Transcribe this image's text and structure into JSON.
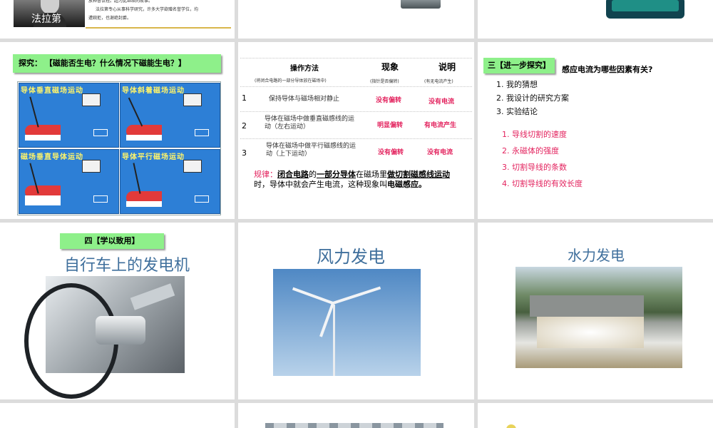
{
  "slide1": {
    "name_caption": "法拉第",
    "bio_line1": "放种督议程。超为此继续的故事。",
    "bio_line2": "法拉第专心从事科学研究，许多大学欲赠名誉学位，均",
    "bio_line3": "遭婉拒，也谢绝封爵。"
  },
  "slide4": {
    "heading": "探究：  【磁能否生电？什么情况下磁能生电？】",
    "panels": [
      {
        "title": "导体垂直磁场运动"
      },
      {
        "title": "导体斜着磁场运动"
      },
      {
        "title": "磁场垂直导体运动"
      },
      {
        "title": "导体平行磁场运动"
      }
    ]
  },
  "slide5": {
    "headers": {
      "method": "操作方法",
      "method_note": "(将闭合电路的一部分导体放在磁场中)",
      "phenomenon": "现象",
      "phenomenon_note": "(指针是否偏转)",
      "explain": "说明",
      "explain_note": "(有无电流产生)"
    },
    "rows": [
      {
        "num": "1",
        "method": "保持导体与磁场相对静止",
        "phenomenon": "没有偏转",
        "explain": "没有电流"
      },
      {
        "num": "2",
        "method": "导体在磁场中做垂直磁感线的运动（左右运动）",
        "phenomenon": "明显偏转",
        "explain": "有电流产生"
      },
      {
        "num": "3",
        "method": "导体在磁场中做平行磁感线的运动（上下运动）",
        "phenomenon": "没有偏转",
        "explain": "没有电流"
      }
    ],
    "rule_label": "规律：",
    "rule_part1": "闭合电路",
    "rule_part2": "的",
    "rule_part3": "一部分导体",
    "rule_part4": "在磁场里",
    "rule_part5": "做切割磁感线运动",
    "rule_part6": "时，导体中就会产生电流，这种现象叫",
    "rule_part7": "电磁感应。"
  },
  "slide6": {
    "tag": "三【进一步探究】",
    "question": "感应电流为哪些因素有关?",
    "steps": [
      "1. 我的猜想",
      "2. 我设计的研究方案",
      "3. 实验结论"
    ],
    "factors": [
      "1.  导线切割的速度",
      "2.  永磁体的强度",
      "3.  切割导线的条数",
      "4.  切割导线的有效长度"
    ]
  },
  "slide7": {
    "tag": "四【学以致用】",
    "title": "自行车上的发电机"
  },
  "slide8": {
    "title": "风力发电"
  },
  "slide9": {
    "title": "水力发电"
  }
}
